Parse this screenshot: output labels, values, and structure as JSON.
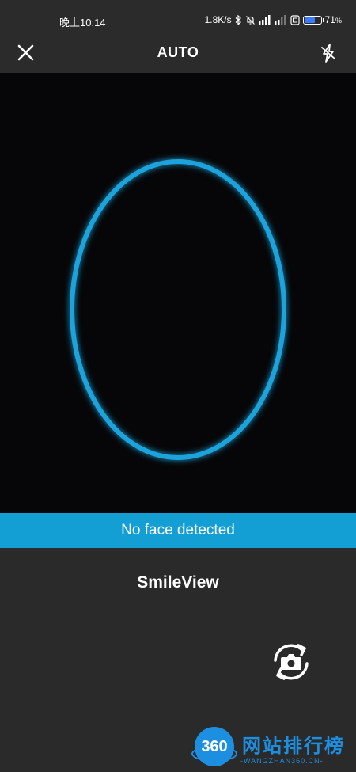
{
  "status_bar": {
    "time": "晚上10:14",
    "network_speed": "1.8K/s",
    "battery_percent_text": "71",
    "battery_unit": "%",
    "battery_level": 0.71,
    "battery_color": "#3b7bff",
    "icons": [
      "bluetooth-icon",
      "mute-icon",
      "signal-icon",
      "signal-icon",
      "sim-card-icon",
      "battery-icon"
    ]
  },
  "top_bar": {
    "title": "AUTO",
    "close_icon": "close-icon",
    "flash_icon": "flash-off-icon"
  },
  "camera": {
    "guide_color": "#1ea3dc",
    "background": "#060608"
  },
  "banner": {
    "text": "No face detected",
    "color": "#139fd3"
  },
  "bottom": {
    "app_name": "SmileView",
    "switch_icon": "switch-camera-icon"
  },
  "watermark": {
    "logo_text": "360",
    "title": "网站排行榜",
    "subtitle": "-WANGZHAN360.CN-"
  }
}
